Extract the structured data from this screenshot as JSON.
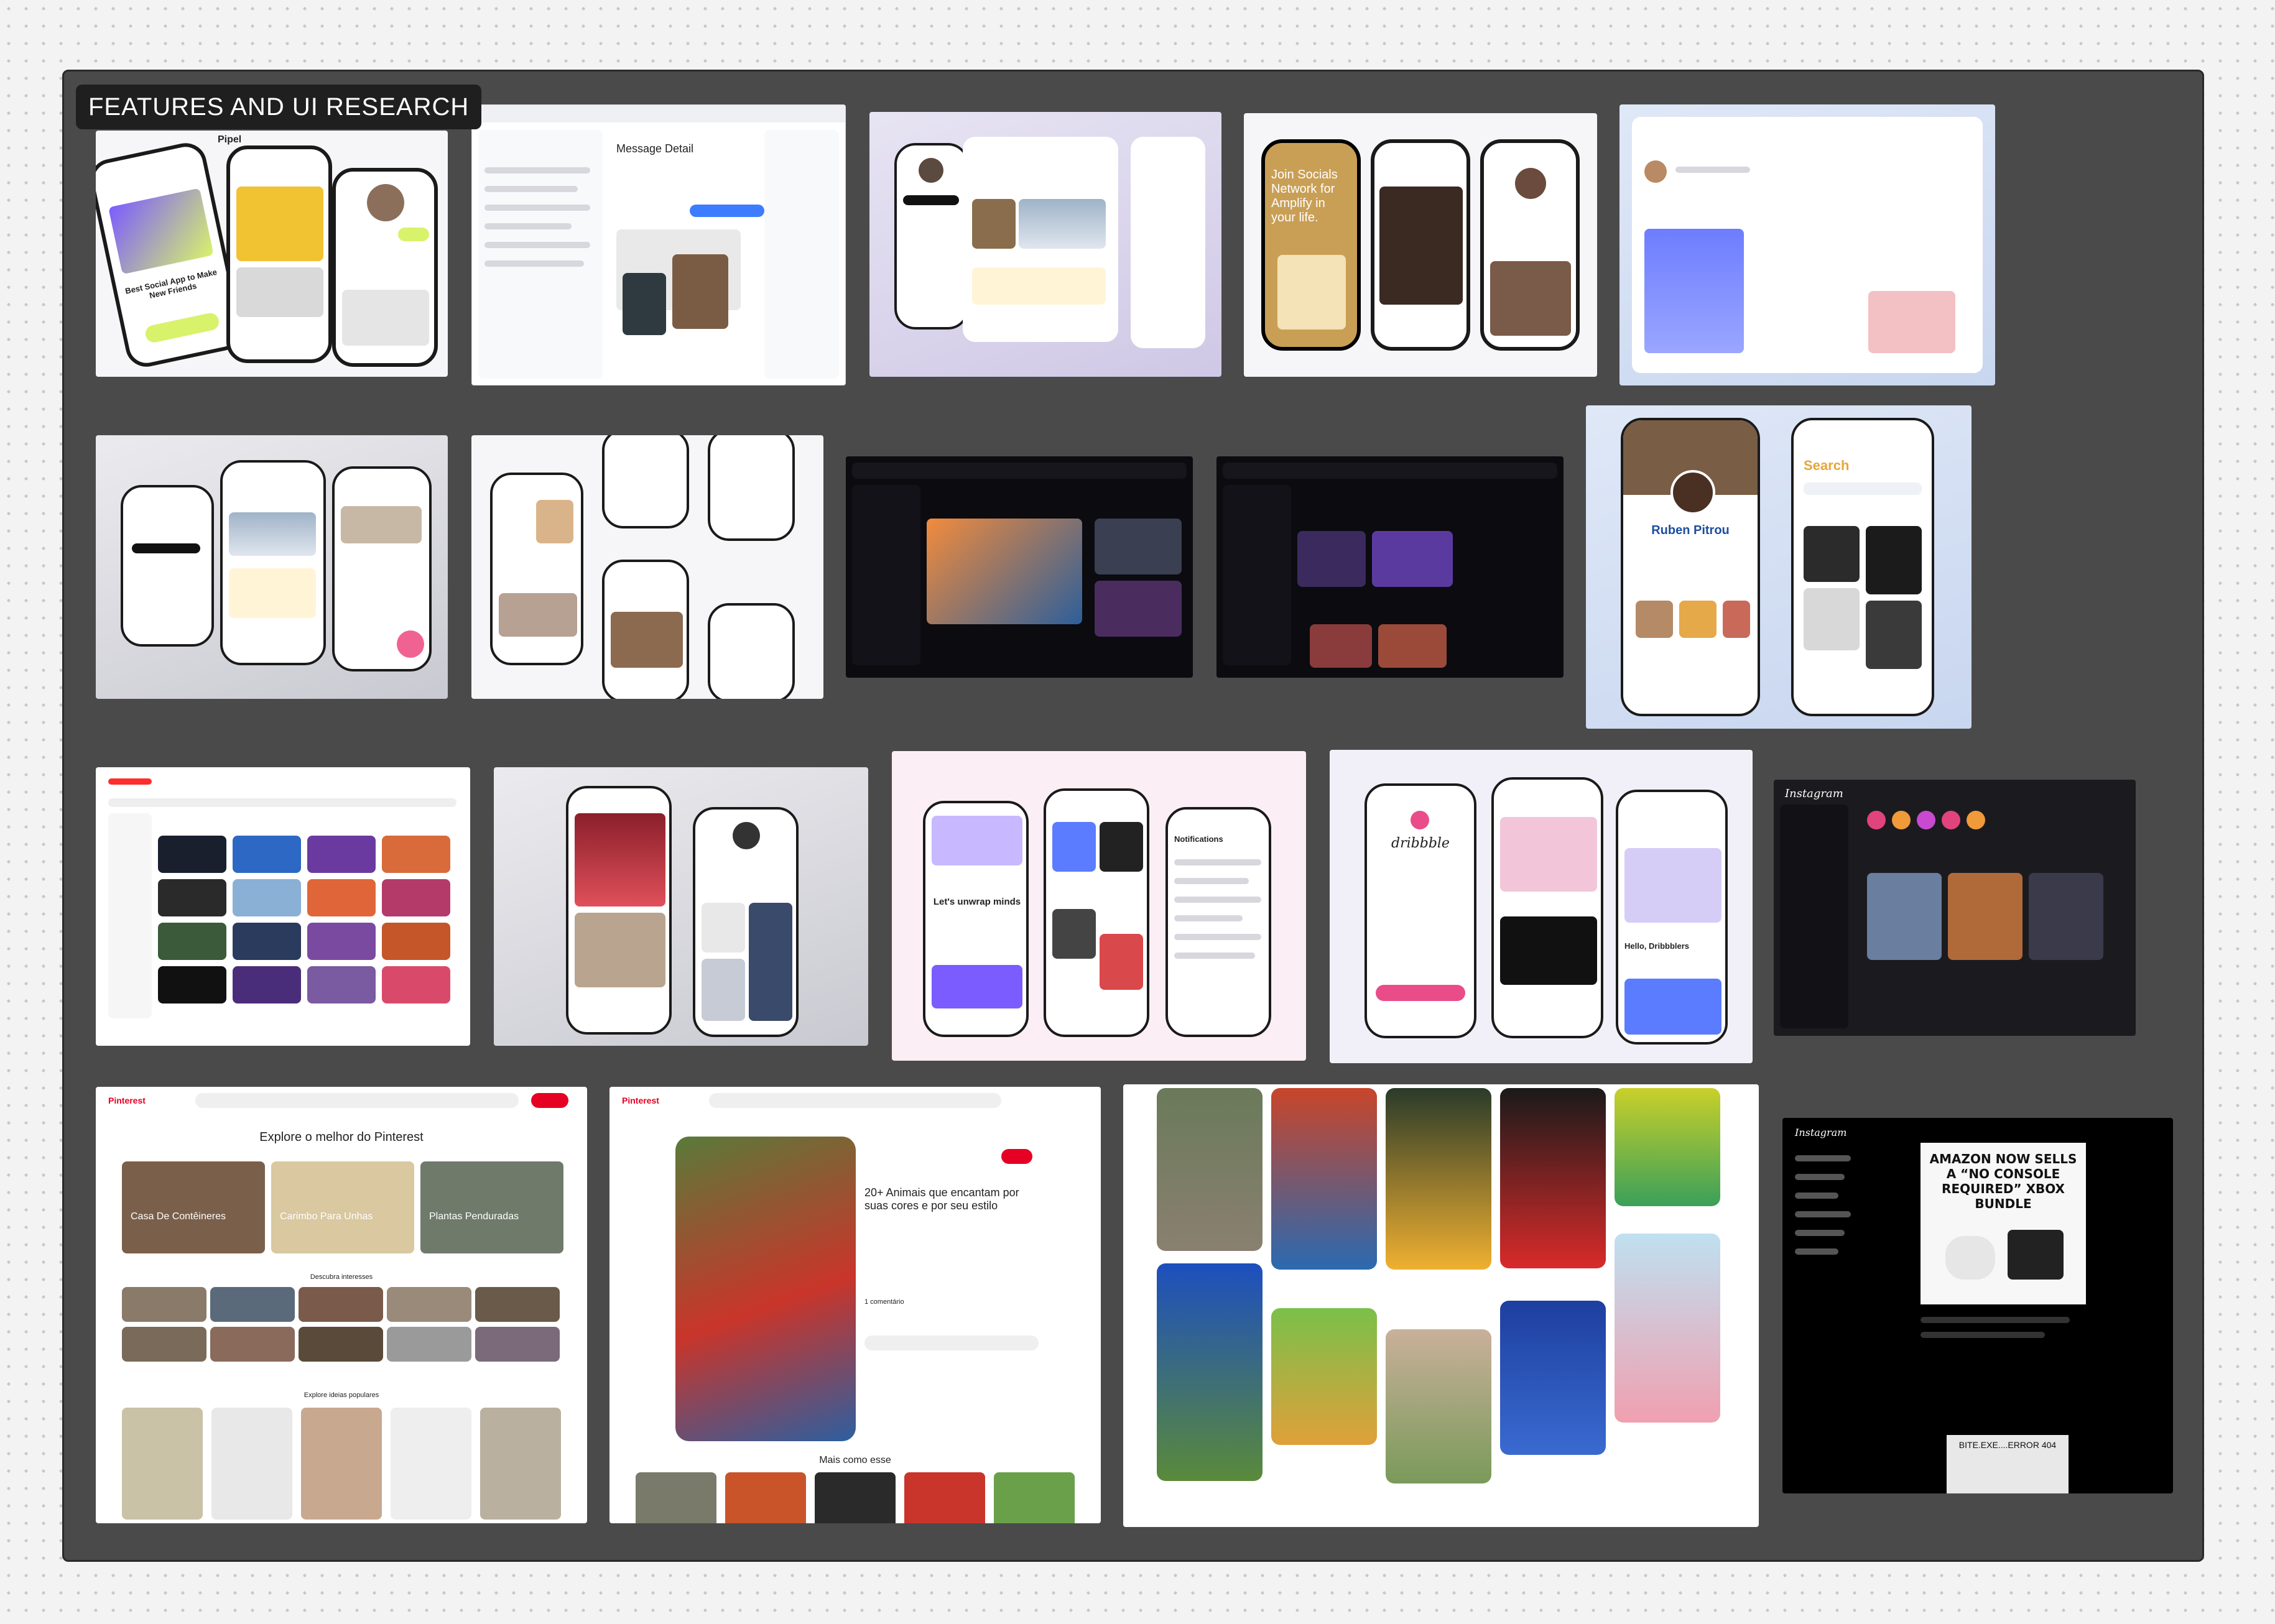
{
  "board": {
    "title": "FEATURES AND UI RESEARCH"
  },
  "shots": {
    "social_app": {
      "brand": "Pipel",
      "headline": "Best Social App to Make New Friends"
    },
    "message_detail": {
      "title": "Message Detail"
    },
    "join_socials": {
      "headline": "Join Socials Network for Amplify in your life."
    },
    "ruben": {
      "name": "Ruben Pitrou",
      "search": "Search"
    },
    "onboarding": {
      "headline": "Let's unwrap minds",
      "notifications": "Notifications"
    },
    "dribbble": {
      "logo": "dribbble",
      "hello": "Hello, Dribbblers"
    },
    "instagram_dark": {
      "logo": "Instagram"
    },
    "pinterest_explore": {
      "brand": "Pinterest",
      "heading": "Explore o melhor do Pinterest",
      "cat1": "Casa De Contêineres",
      "cat2": "Carimbo Para Unhas",
      "cat3": "Plantas Penduradas",
      "interests": "Descubra interesses",
      "popular": "Explore ideias populares"
    },
    "pinterest_pin": {
      "brand": "Pinterest",
      "title": "20+ Animais que encantam por suas cores e por seu estilo",
      "comments": "1 comentário",
      "more": "Mais como esse"
    },
    "instagram_post": {
      "logo": "Instagram",
      "headline": "AMAZON NOW SELLS A “NO CONSOLE REQUIRED” XBOX BUNDLE",
      "footer": "BITE.EXE....ERROR 404"
    }
  },
  "colors": {
    "board": "#4a4a4a",
    "pinterest_red": "#e60023",
    "accent_purple": "#7b5cff",
    "lime": "#d8f26b"
  }
}
